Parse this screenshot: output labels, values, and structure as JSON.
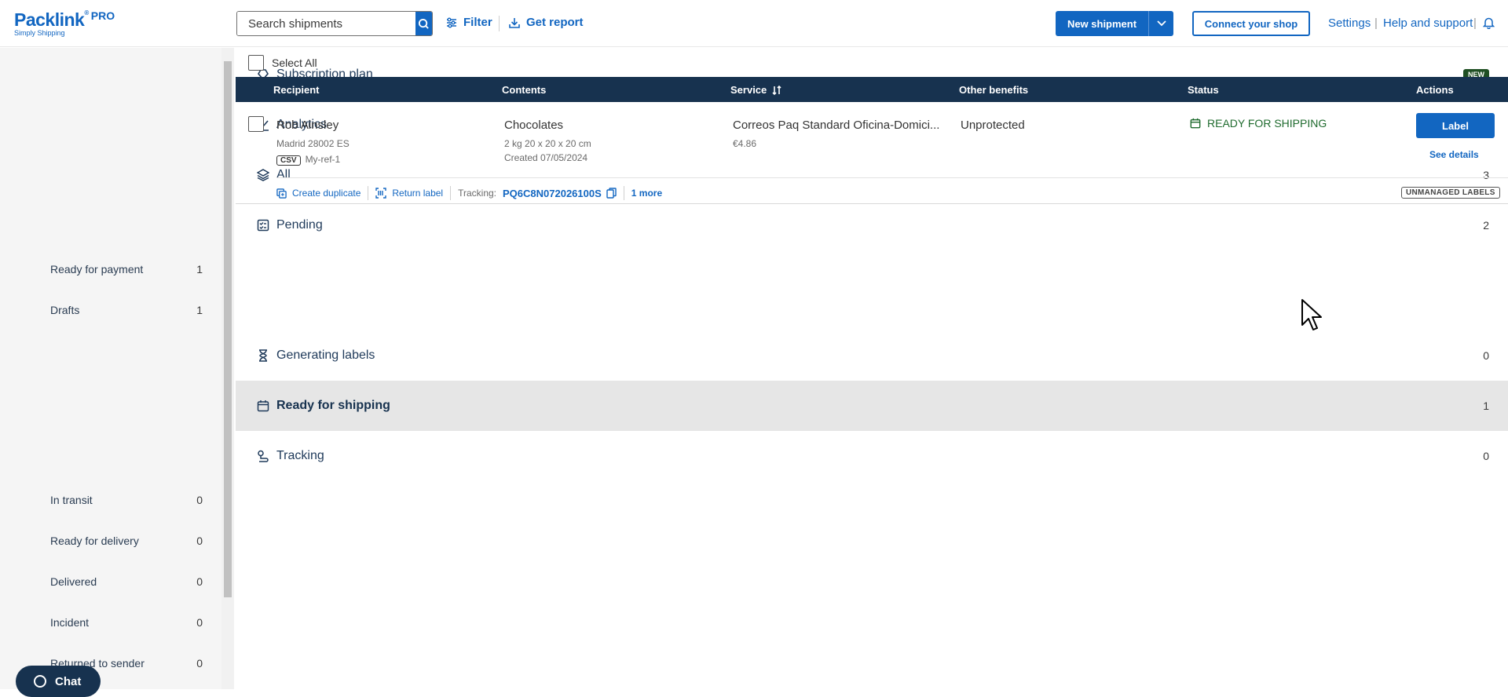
{
  "brand": {
    "name": "Packlink",
    "pro": "PRO",
    "tagline": "Simply Shipping",
    "color": "#1266c1"
  },
  "header": {
    "search_placeholder": "Search shipments",
    "filter_label": "Filter",
    "report_label": "Get report",
    "new_shipment_label": "New shipment",
    "connect_shop_label": "Connect your shop",
    "settings_label": "Settings",
    "help_label": "Help and support"
  },
  "sidebar": {
    "items": [
      {
        "label": "Subscription plan",
        "badge": "NEW",
        "icon": "diamond-icon"
      },
      {
        "label": "Analytics",
        "icon": "chart-icon"
      },
      {
        "label": "All",
        "count": "3",
        "icon": "layers-icon"
      },
      {
        "label": "Pending",
        "count": "2",
        "icon": "checklist-icon"
      },
      {
        "label": "Ready for payment",
        "count": "1"
      },
      {
        "label": "Drafts",
        "count": "1"
      },
      {
        "label": "Generating labels",
        "count": "0",
        "icon": "hourglass-icon"
      },
      {
        "label": "Ready for shipping",
        "count": "1",
        "icon": "package-icon"
      },
      {
        "label": "Tracking",
        "count": "0",
        "icon": "tracking-icon"
      },
      {
        "label": "In transit",
        "count": "0"
      },
      {
        "label": "Ready for delivery",
        "count": "0"
      },
      {
        "label": "Delivered",
        "count": "0"
      },
      {
        "label": "Incident",
        "count": "0"
      },
      {
        "label": "Returned to sender",
        "count": "0"
      }
    ],
    "chat_label": "Chat"
  },
  "table": {
    "select_all": "Select All",
    "columns": [
      "Recipient",
      "Contents",
      "Service",
      "Other benefits",
      "Status",
      "Actions"
    ],
    "row": {
      "recipient_name": "Rob Ainsley",
      "recipient_address": "Madrid 28002 ES",
      "source_tag": "CSV",
      "reference": "My-ref-1",
      "contents_title": "Chocolates",
      "contents_dims": "2 kg 20 x 20 x 20 cm",
      "created": "Created 07/05/2024",
      "service_name": "Correos Paq Standard Oficina-Domici...",
      "service_price": "€4.86",
      "benefits": "Unprotected",
      "status": "READY FOR SHIPPING",
      "label_button": "Label",
      "details_link": "See details",
      "create_duplicate": "Create duplicate",
      "return_label": "Return label",
      "tracking_label": "Tracking:",
      "tracking_code": "PQ6C8N072026100S",
      "more_link": "1 more",
      "unmanaged_badge": "UNMANAGED LABELS"
    }
  }
}
